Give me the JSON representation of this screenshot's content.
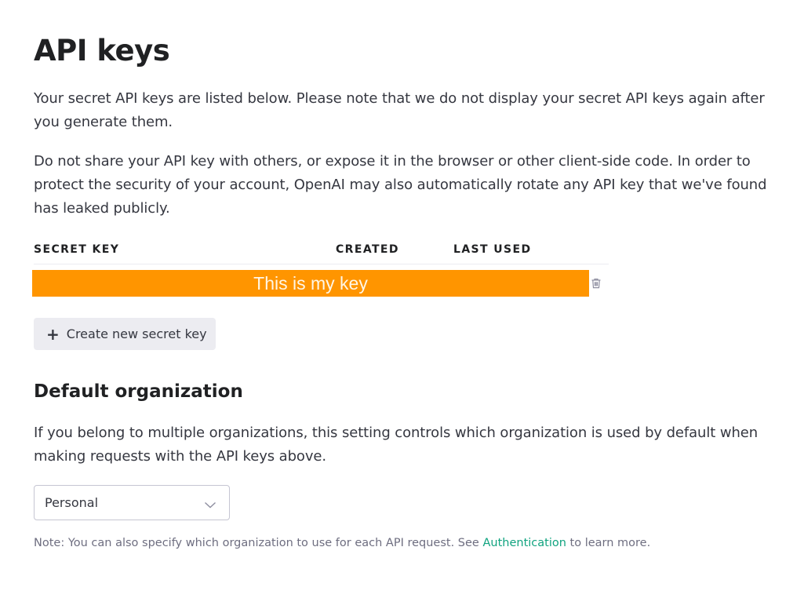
{
  "page": {
    "title": "API keys",
    "intro_1": "Your secret API keys are listed below. Please note that we do not display your secret API keys again after you generate them.",
    "intro_2": "Do not share your API key with others, or expose it in the browser or other client-side code. In order to protect the security of your account, OpenAI may also automatically rotate any API key that we've found has leaked publicly."
  },
  "keys_table": {
    "columns": [
      "SECRET KEY",
      "CREATED",
      "LAST USED"
    ],
    "rows": [
      {
        "secret_key": "This is my key",
        "created": "",
        "last_used": "",
        "action_icon": "trash-icon"
      }
    ],
    "highlight_color": "#ff9500"
  },
  "create_button": {
    "icon": "plus-icon",
    "label": "Create new secret key"
  },
  "default_org": {
    "heading": "Default organization",
    "description": "If you belong to multiple organizations, this setting controls which organization is used by default when making requests with the API keys above.",
    "selected": "Personal",
    "note_prefix": "Note: You can also specify which organization to use for each API request. See ",
    "note_link": "Authentication",
    "note_suffix": " to learn more.",
    "link_color": "#10a37f"
  }
}
